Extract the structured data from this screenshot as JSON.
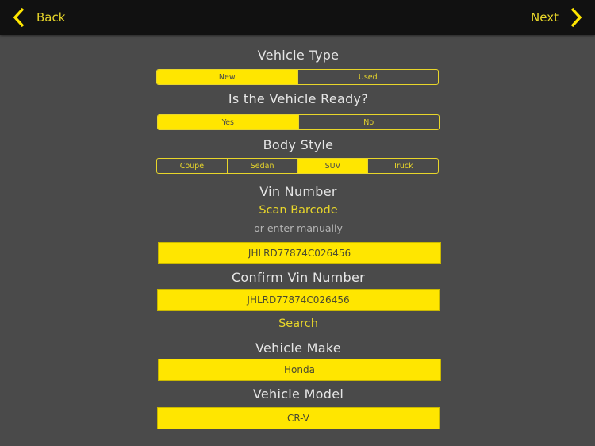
{
  "navbar": {
    "back_label": "Back",
    "next_label": "Next"
  },
  "colors": {
    "accent": "#ffe600",
    "background": "#4a4a4a",
    "navbar": "#111111"
  },
  "form": {
    "vehicle_type": {
      "label": "Vehicle Type",
      "options": [
        "New",
        "Used"
      ],
      "selected": "New"
    },
    "vehicle_ready": {
      "label": "Is the Vehicle Ready?",
      "options": [
        "Yes",
        "No"
      ],
      "selected": "Yes"
    },
    "body_style": {
      "label": "Body Style",
      "options": [
        "Coupe",
        "Sedan",
        "SUV",
        "Truck"
      ],
      "selected": "SUV"
    },
    "vin": {
      "label": "Vin Number",
      "scan_label": "Scan Barcode",
      "hint": "- or enter manually -",
      "value": "JHLRD77874C026456"
    },
    "confirm_vin": {
      "label": "Confirm Vin Number",
      "value": "JHLRD77874C026456"
    },
    "search_label": "Search",
    "make": {
      "label": "Vehicle Make",
      "value": "Honda"
    },
    "model": {
      "label": "Vehicle Model",
      "value": "CR-V"
    }
  }
}
